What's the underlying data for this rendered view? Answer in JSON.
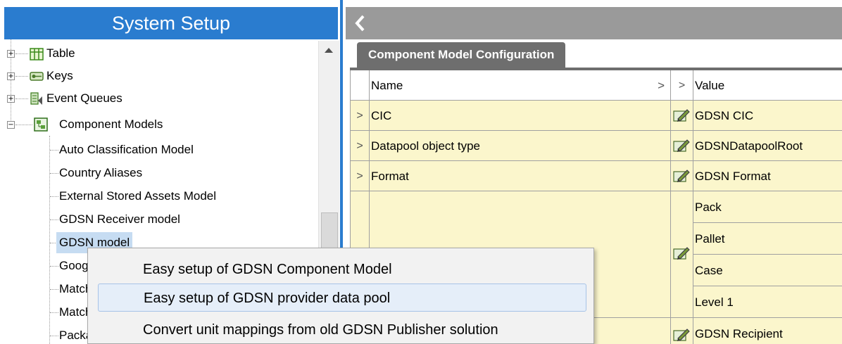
{
  "left_panel": {
    "title": "System Setup",
    "tree": [
      {
        "label": "Table",
        "icon": "table-icon",
        "expander": "+"
      },
      {
        "label": "Keys",
        "icon": "keys-icon",
        "expander": "+"
      },
      {
        "label": "Event Queues",
        "icon": "event-queues-icon",
        "expander": "+"
      },
      {
        "label": "Component Models",
        "icon": "component-models-icon",
        "expander": "-"
      },
      {
        "label": "Auto Classification Model"
      },
      {
        "label": "Country Aliases"
      },
      {
        "label": "External Stored Assets Model"
      },
      {
        "label": "GDSN Receiver model"
      },
      {
        "label": "GDSN model",
        "selected": true
      },
      {
        "label": "Goog"
      },
      {
        "label": "Match"
      },
      {
        "label": "Match"
      },
      {
        "label": "Packa"
      }
    ]
  },
  "right_panel": {
    "tab_title": "Component Model Configuration",
    "columns": {
      "name": "Name",
      "name_chevron": ">",
      "mid_chevron": ">",
      "value": "Value"
    },
    "rows": [
      {
        "chevron": ">",
        "name": "CIC",
        "value": "GDSN CIC"
      },
      {
        "chevron": ">",
        "name": "Datapool object type",
        "value": "GDSNDatapoolRoot"
      },
      {
        "chevron": ">",
        "name": "Format",
        "value": "GDSN Format"
      }
    ],
    "multi_values": [
      "Pack",
      "Pallet",
      "Case",
      "Level 1"
    ],
    "last_value": "GDSN Recipient",
    "icons": {
      "back": "chevron-left-icon",
      "edit": "edit-pencil-icon"
    }
  },
  "context_menu": {
    "items": [
      {
        "label": "Easy setup of GDSN Component Model"
      },
      {
        "label": "Easy setup of GDSN provider data pool",
        "hovered": true
      },
      {
        "label": "Convert unit mappings from old GDSN Publisher solution"
      }
    ]
  },
  "colors": {
    "accent_blue": "#2a7ccf",
    "header_gray": "#9a9a9a",
    "tab_gray": "#6e6e6e",
    "row_yellow": "#fbf6cc",
    "selection": "#c6dcf2"
  }
}
